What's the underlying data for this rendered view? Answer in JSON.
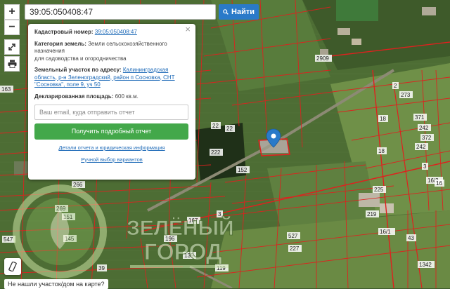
{
  "search": {
    "value": "39:05:050408:47",
    "button_label": "Найти",
    "button_icon": "search-icon"
  },
  "controls": {
    "zoom_in": "+",
    "zoom_out": "−",
    "fullscreen_icon": "expand-icon",
    "print_icon": "printer-icon",
    "ruler_icon": "ruler-icon"
  },
  "popup": {
    "cadastral_label": "Кадастровый номер:",
    "cadastral_value": "39:05:050408:47",
    "category_label": "Категория земель:",
    "category_value": "Земли сельскохозяйственного назначения",
    "category_usage": "для садоводства и огородничества",
    "address_label": "Земельный участок по адресу:",
    "address_value": "Калининградская область, р-н Зеленоградский, район п Сосновка, СНТ \"Сосновка\", поле 9, уч 50",
    "area_label": "Декларированная площадь:",
    "area_value": "600 кв.м.",
    "email_placeholder": "Ваш email, куда отправить отчет",
    "report_button": "Получить подробный отчет",
    "details_link": "Детали отчета и юридическая информация",
    "manual_link": "Ручной выбор вариантов",
    "close_symbol": "×"
  },
  "help_text": "Не нашли участок/дом на карте?",
  "watermark": {
    "line1": "ЗЕЛЁНЫЙ",
    "line2": "ГОРОД"
  },
  "parcel_labels": [
    "163",
    "2909",
    "2",
    "273",
    "18",
    "371",
    "242",
    "372",
    "22",
    "222",
    "22",
    "152",
    "18",
    "242",
    "3",
    "16/2",
    "225",
    "16",
    "266",
    "269",
    "3",
    "219",
    "151",
    "145",
    "527",
    "135",
    "227",
    "43",
    "16/1",
    "547",
    "39",
    "119",
    "196",
    "167",
    "1342"
  ],
  "colors": {
    "parcel_line": "#e0201e",
    "search_button": "#2a7ac9",
    "report_button": "#43a84a",
    "link": "#1f6bb8",
    "marker": "#2a7ac9"
  }
}
